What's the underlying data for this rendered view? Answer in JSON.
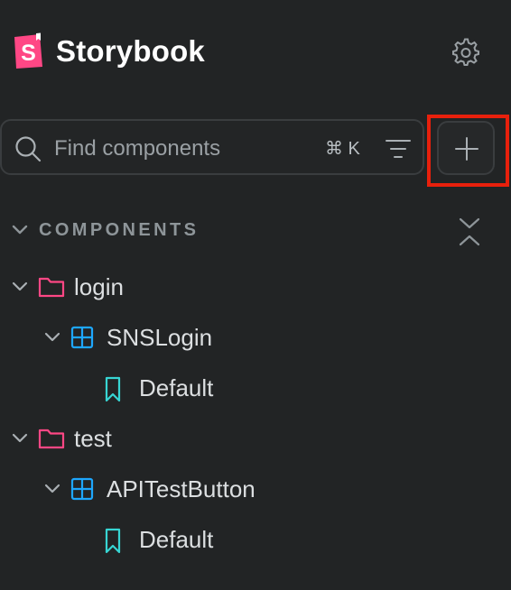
{
  "app": {
    "title": "Storybook",
    "logo_letter": "S",
    "logo_color": "#ff4785"
  },
  "icons": {
    "settings": "gear-icon",
    "search": "search-icon",
    "filter": "filter-icon",
    "add": "plus-icon",
    "collapse_all": "collapse-all-icon",
    "group": "folder-icon",
    "component": "component-icon",
    "story": "bookmark-icon"
  },
  "search": {
    "placeholder": "Find components",
    "value": "",
    "shortcut": "⌘ K"
  },
  "sidebar": {
    "section_title": "COMPONENTS",
    "tree": [
      {
        "type": "group",
        "label": "login",
        "expanded": true,
        "children": [
          {
            "type": "component",
            "label": "SNSLogin",
            "expanded": true,
            "stories": [
              {
                "type": "story",
                "label": "Default"
              }
            ]
          }
        ]
      },
      {
        "type": "group",
        "label": "test",
        "expanded": true,
        "children": [
          {
            "type": "component",
            "label": "APITestButton",
            "expanded": true,
            "stories": [
              {
                "type": "story",
                "label": "Default"
              }
            ]
          }
        ]
      }
    ]
  },
  "colors": {
    "background": "#222425",
    "group_icon": "#ff4785",
    "component_icon": "#1ea7fd",
    "story_icon": "#37d5d3",
    "highlight": "#e8200c"
  }
}
